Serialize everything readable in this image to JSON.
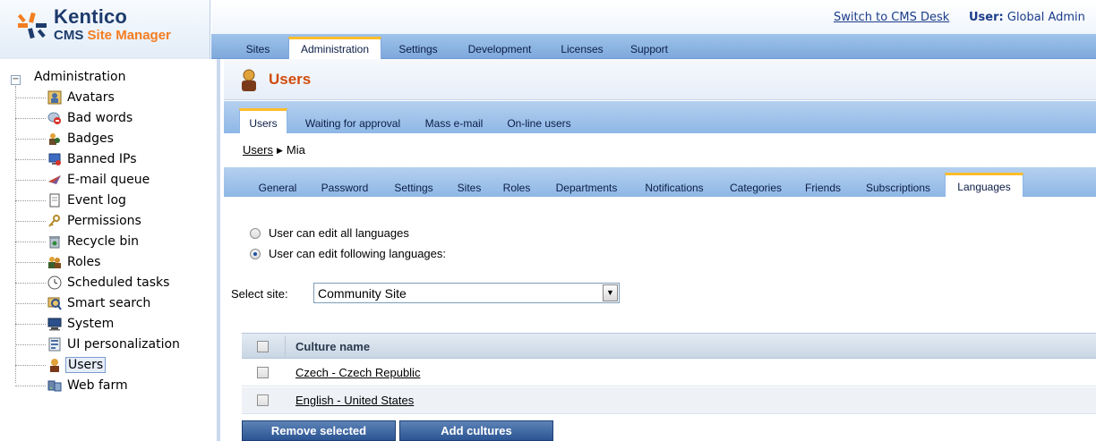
{
  "header": {
    "logo_title": "Kentico",
    "logo_sub_1": "CMS",
    "logo_sub_2": "Site Manager",
    "switch_link": "Switch to CMS Desk",
    "user_label": "User:",
    "user_name": "Global Admin"
  },
  "mainnav": {
    "tabs": [
      "Sites",
      "Administration",
      "Settings",
      "Development",
      "Licenses",
      "Support"
    ],
    "active": "Administration"
  },
  "tree": {
    "root": "Administration",
    "items": [
      {
        "label": "Avatars",
        "icon": "avatars-icon"
      },
      {
        "label": "Bad words",
        "icon": "bad-words-icon"
      },
      {
        "label": "Badges",
        "icon": "badges-icon"
      },
      {
        "label": "Banned IPs",
        "icon": "banned-ips-icon"
      },
      {
        "label": "E-mail queue",
        "icon": "email-queue-icon"
      },
      {
        "label": "Event log",
        "icon": "event-log-icon"
      },
      {
        "label": "Permissions",
        "icon": "permissions-icon"
      },
      {
        "label": "Recycle bin",
        "icon": "recycle-bin-icon"
      },
      {
        "label": "Roles",
        "icon": "roles-icon"
      },
      {
        "label": "Scheduled tasks",
        "icon": "scheduled-tasks-icon"
      },
      {
        "label": "Smart search",
        "icon": "smart-search-icon"
      },
      {
        "label": "System",
        "icon": "system-icon"
      },
      {
        "label": "UI personalization",
        "icon": "ui-personalization-icon"
      },
      {
        "label": "Users",
        "icon": "users-icon"
      },
      {
        "label": "Web farm",
        "icon": "web-farm-icon"
      }
    ],
    "selected": "Users"
  },
  "page": {
    "title": "Users"
  },
  "subnav": {
    "tabs": [
      "Users",
      "Waiting for approval",
      "Mass e-mail",
      "On-line users"
    ],
    "active": "Users"
  },
  "breadcrumb": {
    "parent": "Users",
    "current": "Mia"
  },
  "usertabs": {
    "tabs": [
      "General",
      "Password",
      "Settings",
      "Sites",
      "Roles",
      "Departments",
      "Notifications",
      "Categories",
      "Friends",
      "Subscriptions",
      "Languages"
    ],
    "active": "Languages"
  },
  "languages": {
    "option_all": "User can edit all languages",
    "option_following": "User can edit following languages:",
    "selected_option": "following",
    "site_label": "Select site:",
    "site_value": "Community Site",
    "grid_header": "Culture name",
    "cultures": [
      "Czech - Czech Republic",
      "English - United States"
    ],
    "remove_button": "Remove selected",
    "add_button": "Add cultures"
  },
  "colors": {
    "accent_orange": "#f47d20",
    "title_orange": "#d14b0b",
    "tab_blue": "#8eb7e6",
    "active_tab_top": "#ffbd2a",
    "button_blue": "#2b5593"
  }
}
